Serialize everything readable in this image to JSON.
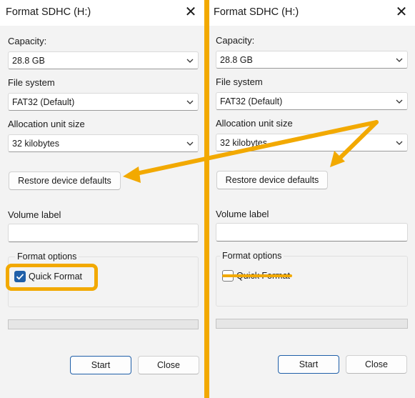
{
  "dialogs": [
    {
      "title": "Format SDHC (H:)",
      "capacity_label": "Capacity:",
      "capacity_value": "28.8 GB",
      "filesystem_label": "File system",
      "filesystem_value": "FAT32 (Default)",
      "allocation_label": "Allocation unit size",
      "allocation_value": "32 kilobytes",
      "restore_label": "Restore device defaults",
      "volume_label": "Volume label",
      "volume_value": "",
      "format_options_label": "Format options",
      "quick_format_label": "Quick Format",
      "quick_format_checked": true,
      "progress": 0,
      "start_label": "Start",
      "close_label": "Close"
    },
    {
      "title": "Format SDHC (H:)",
      "capacity_label": "Capacity:",
      "capacity_value": "28.8 GB",
      "filesystem_label": "File system",
      "filesystem_value": "FAT32 (Default)",
      "allocation_label": "Allocation unit size",
      "allocation_value": "32 kilobytes",
      "restore_label": "Restore device defaults",
      "volume_label": "Volume label",
      "volume_value": "",
      "format_options_label": "Format options",
      "quick_format_label": "Quick Format",
      "quick_format_checked": false,
      "progress": 0,
      "start_label": "Start",
      "close_label": "Close"
    }
  ],
  "colors": {
    "annotation": "#f2a900",
    "checkbox_accent": "#1f5fa8",
    "dialog_background": "#f3f3f3"
  },
  "icons": {
    "close": "close-icon",
    "dropdown": "chevron-down-icon",
    "check": "check-icon"
  }
}
